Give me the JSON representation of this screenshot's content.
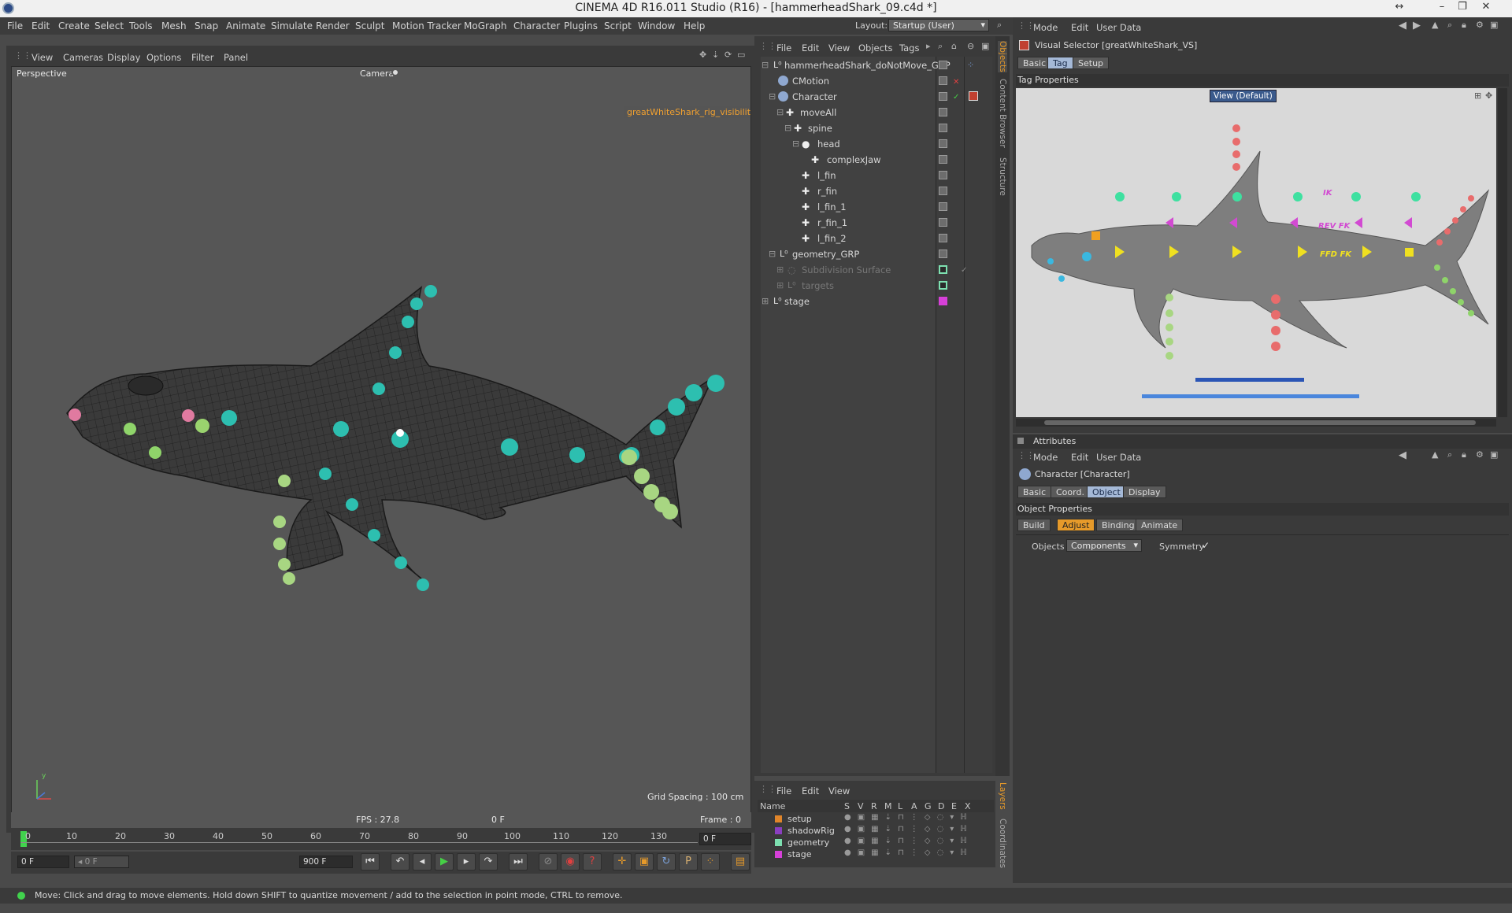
{
  "window": {
    "title": "CINEMA 4D R16.011 Studio (R16) - [hammerheadShark_09.c4d *]"
  },
  "menubar": [
    "File",
    "Edit",
    "Create",
    "Select",
    "Tools",
    "Mesh",
    "Snap",
    "Animate",
    "Simulate",
    "Render",
    "Sculpt",
    "Motion Tracker",
    "MoGraph",
    "Character",
    "Plugins",
    "Script",
    "Window",
    "Help"
  ],
  "layout": {
    "label": "Layout:",
    "value": "Startup (User)"
  },
  "viewport": {
    "menu": [
      "View",
      "Cameras",
      "Display",
      "Options",
      "Filter",
      "Panel"
    ],
    "view_name": "Perspective",
    "camera_label": "Camera",
    "hud_tag": "greatWhiteShark_rig_visibility",
    "grid_spacing": "Grid Spacing : 100 cm",
    "fps": "FPS : 27.8",
    "frame_center": "0 F",
    "frame": "Frame : 0"
  },
  "objects": {
    "menu": [
      "File",
      "Edit",
      "View",
      "Objects",
      "Tags"
    ],
    "rows": [
      {
        "name": "hammerheadShark_doNotMove_GRP"
      },
      {
        "name": "CMotion"
      },
      {
        "name": "Character"
      },
      {
        "name": "moveAll"
      },
      {
        "name": "spine"
      },
      {
        "name": "head"
      },
      {
        "name": "complexJaw"
      },
      {
        "name": "l_fin"
      },
      {
        "name": "r_fin"
      },
      {
        "name": "l_fin_1"
      },
      {
        "name": "r_fin_1"
      },
      {
        "name": "l_fin_2"
      },
      {
        "name": "geometry_GRP"
      },
      {
        "name": "Subdivision Surface"
      },
      {
        "name": "targets"
      },
      {
        "name": "stage"
      }
    ]
  },
  "side_tabs_top": [
    "Objects",
    "Content Browser",
    "Structure"
  ],
  "side_tabs_bottom": [
    "Layers",
    "Coordinates"
  ],
  "attr_top": {
    "menu": [
      "Mode",
      "Edit",
      "User Data"
    ],
    "object_title": "Visual Selector [greatWhiteShark_VS]",
    "tabs": [
      "Basic",
      "Tag",
      "Setup"
    ],
    "active_tab": "Tag",
    "section": "Tag Properties",
    "view_button": "View (Default)",
    "labels": {
      "ik": "IK",
      "rev_fk": "REV FK",
      "ffd_fk": "FFD FK"
    }
  },
  "attributes": {
    "header": "Attributes",
    "menu": [
      "Mode",
      "Edit",
      "User Data"
    ],
    "object_title": "Character [Character]",
    "tabs": [
      "Basic",
      "Coord.",
      "Object",
      "Display"
    ],
    "active_tab": "Object",
    "section": "Object Properties",
    "subtabs": [
      "Build",
      "Adjust",
      "Binding",
      "Animate"
    ],
    "active_subtab": "Adjust",
    "objects_label": "Objects",
    "objects_value": "Components",
    "symmetry_label": "Symmetry",
    "symmetry_check": "✓"
  },
  "layers": {
    "menu": [
      "File",
      "Edit",
      "View"
    ],
    "columns": [
      "Name",
      "S",
      "V",
      "R",
      "M",
      "L",
      "A",
      "G",
      "D",
      "E",
      "X"
    ],
    "rows": [
      {
        "name": "setup",
        "color": "#e0852a"
      },
      {
        "name": "shadowRig",
        "color": "#8a3fc0"
      },
      {
        "name": "geometry",
        "color": "#7de0b0"
      },
      {
        "name": "stage",
        "color": "#d640d8"
      }
    ]
  },
  "timeline": {
    "ticks": [
      "0",
      "10",
      "20",
      "30",
      "40",
      "50",
      "60",
      "70",
      "80",
      "90",
      "100",
      "110",
      "120",
      "130"
    ],
    "current_field": "0 F",
    "start_field": "0 F",
    "range_field": "0 F",
    "end_field": "900 F"
  },
  "statusbar": {
    "text": "Move: Click and drag to move elements. Hold down SHIFT to quantize movement / add to the selection in point mode, CTRL to remove."
  },
  "colors": {
    "accent_orange": "#e69a2a",
    "tab_active": "#a5b9d7",
    "teal": "#2dbfb0",
    "green": "#8fd46a",
    "pink": "#e07aa0"
  }
}
